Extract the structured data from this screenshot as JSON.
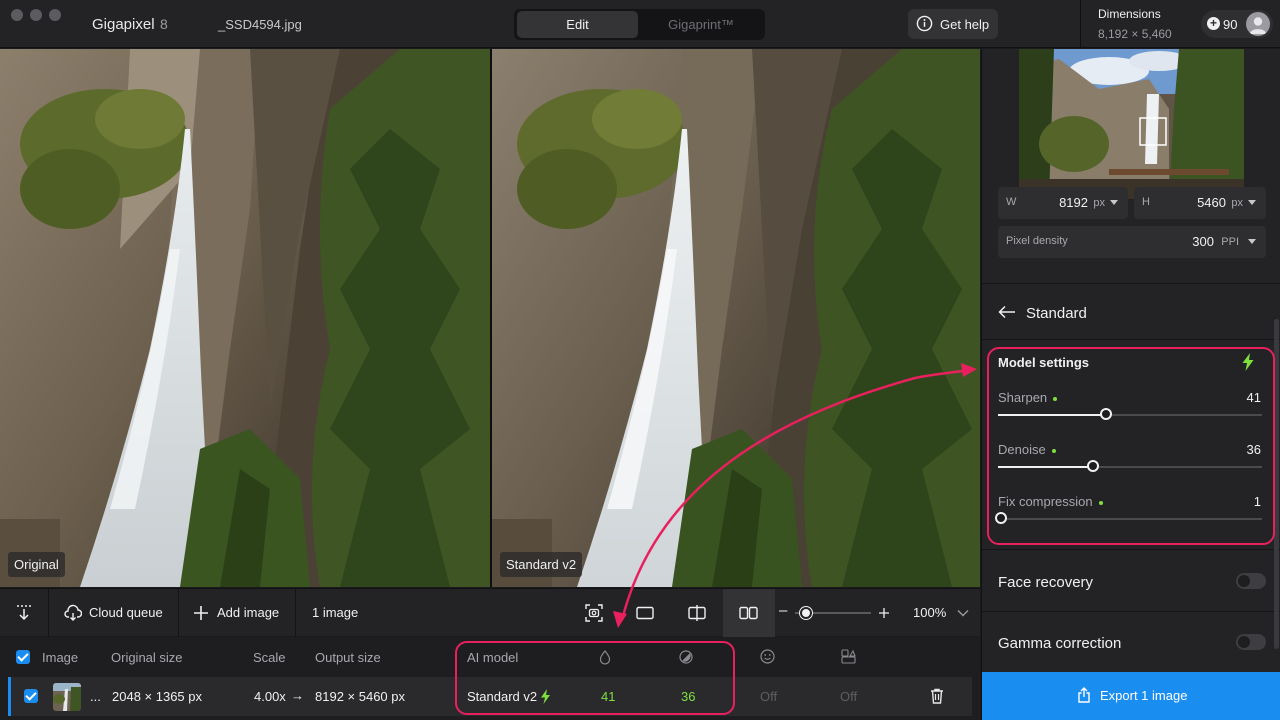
{
  "titlebar": {
    "app_name": "Gigapixel",
    "app_version": "8",
    "file_name": "_SSD4594.jpg",
    "tabs": [
      "Edit",
      "Gigaprint™"
    ],
    "active_tab": "Edit",
    "help_label": "Get help",
    "dimensions_title": "Dimensions",
    "dimensions_value": "8,192 × 5,460",
    "credits": "90"
  },
  "viewer": {
    "left_label": "Original",
    "right_label": "Standard v2"
  },
  "toolbar": {
    "cloud_queue": "Cloud queue",
    "add_image": "Add image",
    "image_count": "1 image",
    "zoom": "100%",
    "zoom_level": 0.15
  },
  "table": {
    "headers": {
      "image": "Image",
      "original_size": "Original size",
      "scale": "Scale",
      "output_size": "Output size",
      "ai_model": "AI model"
    },
    "row": {
      "ellipsis": "...",
      "original_size": "2048 × 1365 px",
      "scale": "4.00x",
      "output_size": "8192 × 5460 px",
      "ai_model": "Standard v2",
      "sharpen": "41",
      "denoise": "36",
      "face": "Off",
      "gamma": "Off"
    }
  },
  "panel": {
    "w_label": "W",
    "w_value": "8192",
    "w_unit": "px",
    "h_label": "H",
    "h_value": "5460",
    "h_unit": "px",
    "density_label": "Pixel density",
    "density_value": "300",
    "density_unit": "PPI",
    "model_title": "Standard",
    "model_settings": "Model settings",
    "sliders": [
      {
        "label": "Sharpen",
        "value": "41",
        "level": 41
      },
      {
        "label": "Denoise",
        "value": "36",
        "level": 36
      },
      {
        "label": "Fix compression",
        "value": "1",
        "level": 1
      }
    ],
    "face_recovery": "Face recovery",
    "gamma_correction": "Gamma correction",
    "export_label": "Export 1 image"
  },
  "colors": {
    "accent_blue": "#1a8df0",
    "highlight_pink": "#e8215e",
    "green": "#7ee03c"
  }
}
